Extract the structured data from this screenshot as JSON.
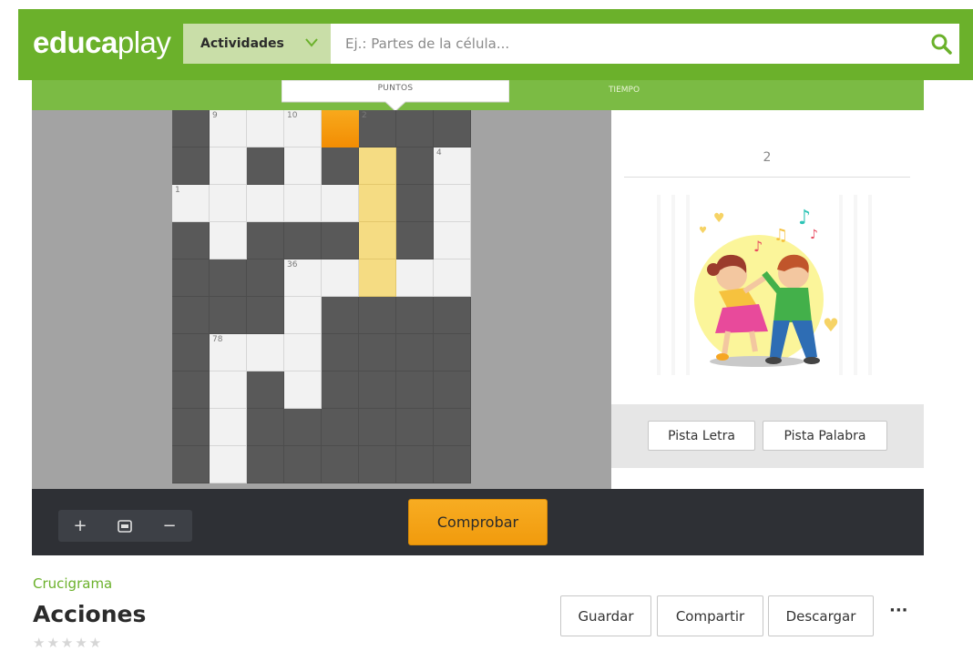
{
  "header": {
    "logo_bold": "educa",
    "logo_thin": "play",
    "activities_label": "Actividades",
    "search_placeholder": "Ej.: Partes de la célula..."
  },
  "stats": {
    "points_label": "PUNTOS",
    "time_label": "TIEMPO"
  },
  "crossword": {
    "grid": [
      "BWWWABBB",
      "BWBWBHBW",
      "WWWWWHBW",
      "BWBBBHBW",
      "BBBWWHWW",
      "BBBWBBBB",
      "BWWWBBBB",
      "BWBWBBBB",
      "BWBBBBBB",
      "BWBBBBBB"
    ],
    "cell_numbers": [
      {
        "row": 0,
        "col": 1,
        "label": "9"
      },
      {
        "row": 0,
        "col": 3,
        "label": "10"
      },
      {
        "row": 0,
        "col": 5,
        "label": "2"
      },
      {
        "row": 1,
        "col": 7,
        "label": "4"
      },
      {
        "row": 2,
        "col": 0,
        "label": "1"
      },
      {
        "row": 4,
        "col": 3,
        "label": "36"
      },
      {
        "row": 6,
        "col": 1,
        "label": "78"
      }
    ]
  },
  "clue": {
    "number": "2",
    "image_name": "children-dancing-image"
  },
  "hints": {
    "letter_label": "Pista Letra",
    "word_label": "Pista Palabra"
  },
  "toolbar": {
    "zoom_in": "+",
    "zoom_out": "−",
    "check_label": "Comprobar"
  },
  "activity": {
    "type": "Crucigrama",
    "title": "Acciones",
    "stars": "★★★★★",
    "save_label": "Guardar",
    "share_label": "Compartir",
    "download_label": "Descargar",
    "more_label": "···"
  },
  "colors": {
    "brand_green": "#6bb12b",
    "active_cell": "#f39c12",
    "highlight_cell": "#f5dc83",
    "check_button": "#f5a623"
  }
}
